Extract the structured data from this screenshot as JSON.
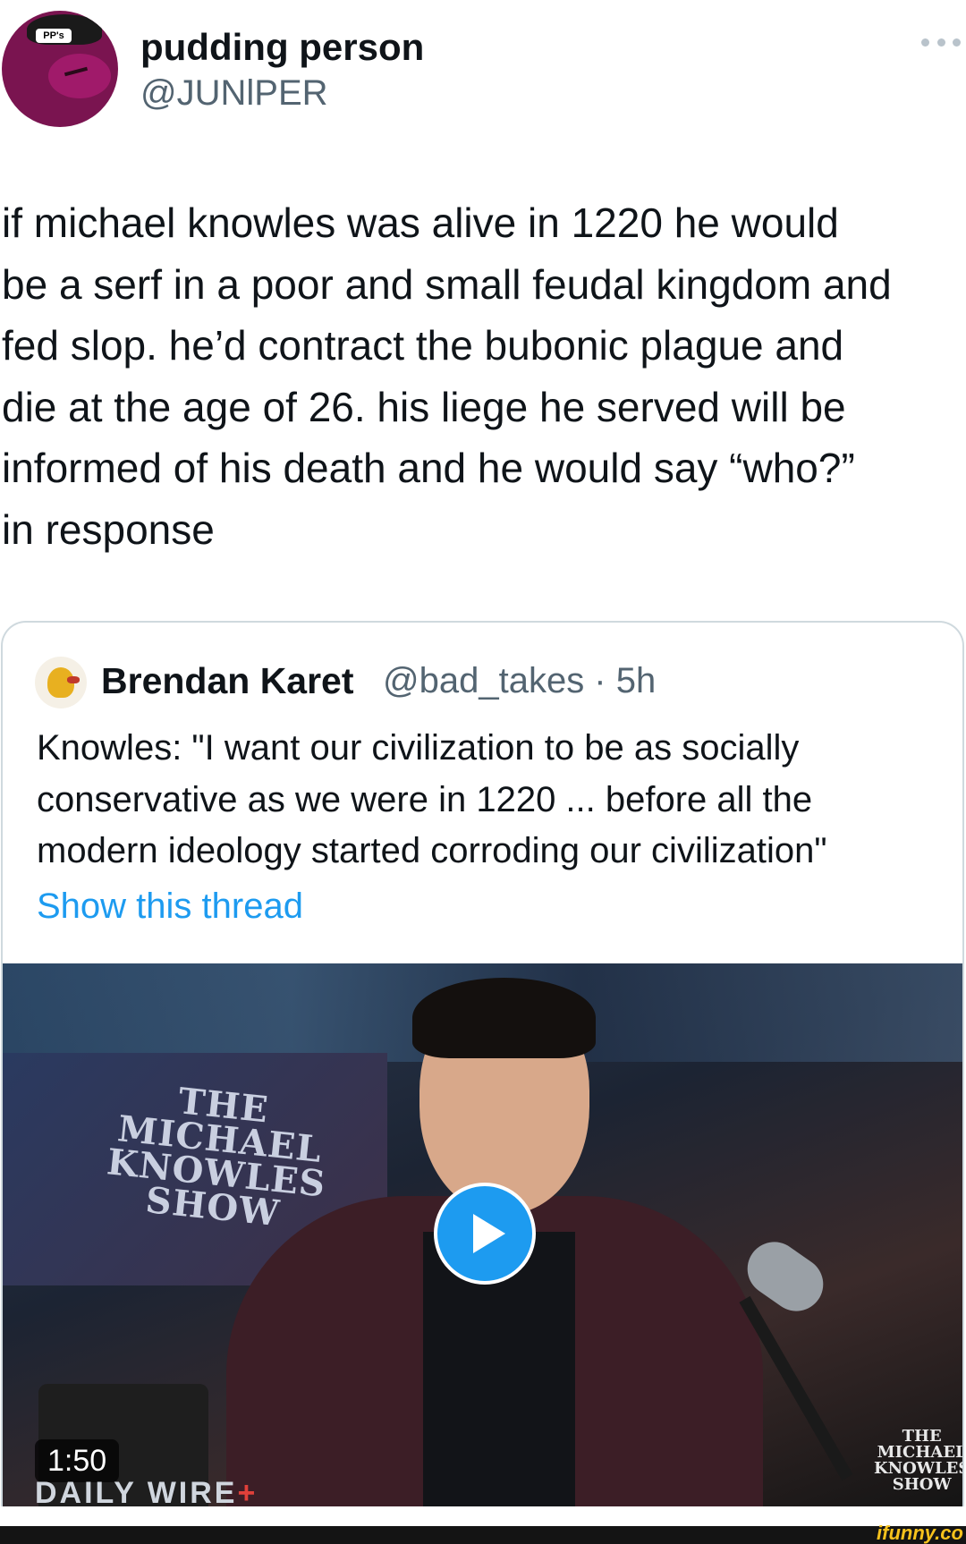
{
  "tweet": {
    "display_name": "pudding person",
    "handle": "@JUNlPER",
    "avatar_badge": "PP's",
    "text": "if michael knowles was alive in 1220 he would\nbe a serf in a poor and small feudal kingdom and\nfed slop.  he’d contract the bubonic plague and\ndie at the age of 26.  his liege  he served will be\ninformed of his death and he would say “who?”\nin response"
  },
  "quote": {
    "display_name": "Brendan Karet",
    "meta": "@bad_takes · 5h",
    "text": "Knowles: \"I want our civilization to be as socially\nconservative as we were in 1220 ... before all the\nmodern ideology started corroding our civilization\"",
    "link": "Show this thread"
  },
  "video": {
    "duration": "1:50",
    "show_logo": "THE\nMICHAEL\nKNOWLES\nSHOW",
    "watermark_left": "DAILY WIRE",
    "watermark_plus": "+",
    "watermark_right": "THE\nMICHAEL\nKNOWLES\nSHOW"
  },
  "footer": {
    "logo": "ifunny.co"
  },
  "icons": {
    "more": "more-horizontal-icon",
    "play": "play-icon"
  },
  "colors": {
    "link": "#1d9bf0",
    "secondary_text": "#536471",
    "play_button": "#1d9bf0",
    "border": "#cfd9de"
  }
}
